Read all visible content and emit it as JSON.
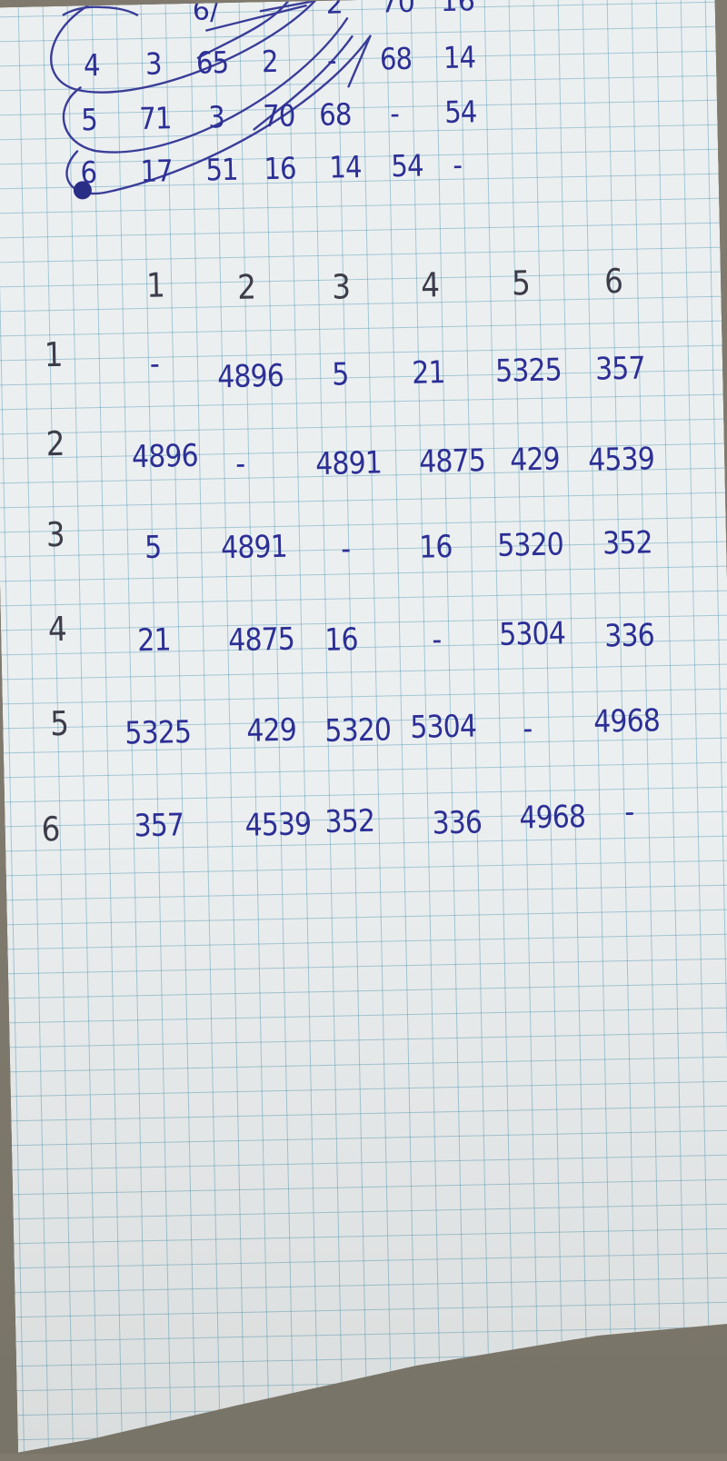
{
  "photo": {
    "ink_color": "#2c2f95",
    "paper_color": "#eceff0",
    "grid_color": "#4a96b4",
    "background_color": "#7f7a6d"
  },
  "top_table": {
    "rows": [
      {
        "label": "4",
        "cells": [
          "3",
          "65",
          "2",
          "-",
          "68",
          "14"
        ]
      },
      {
        "label": "5",
        "cells": [
          "71",
          "3",
          "70",
          "68",
          "-",
          "54"
        ]
      },
      {
        "label": "6",
        "cells": [
          "17",
          "51",
          "16",
          "14",
          "54",
          "-"
        ]
      }
    ]
  },
  "matrix": {
    "col_headers": [
      "1",
      "2",
      "3",
      "4",
      "5",
      "6"
    ],
    "rows": [
      {
        "label": "1",
        "cells": [
          "-",
          "4896",
          "5",
          "21",
          "5325",
          "357"
        ]
      },
      {
        "label": "2",
        "cells": [
          "4896",
          "-",
          "4891",
          "4875",
          "429",
          "4539"
        ]
      },
      {
        "label": "3",
        "cells": [
          "5",
          "4891",
          "-",
          "16",
          "5320",
          "352"
        ]
      },
      {
        "label": "4",
        "cells": [
          "21",
          "4875",
          "16",
          "-",
          "5304",
          "336"
        ]
      },
      {
        "label": "5",
        "cells": [
          "5325",
          "429",
          "5320",
          "5304",
          "-",
          "4968"
        ]
      },
      {
        "label": "6",
        "cells": [
          "357",
          "4539",
          "352",
          "336",
          "4968",
          "-"
        ]
      }
    ]
  }
}
